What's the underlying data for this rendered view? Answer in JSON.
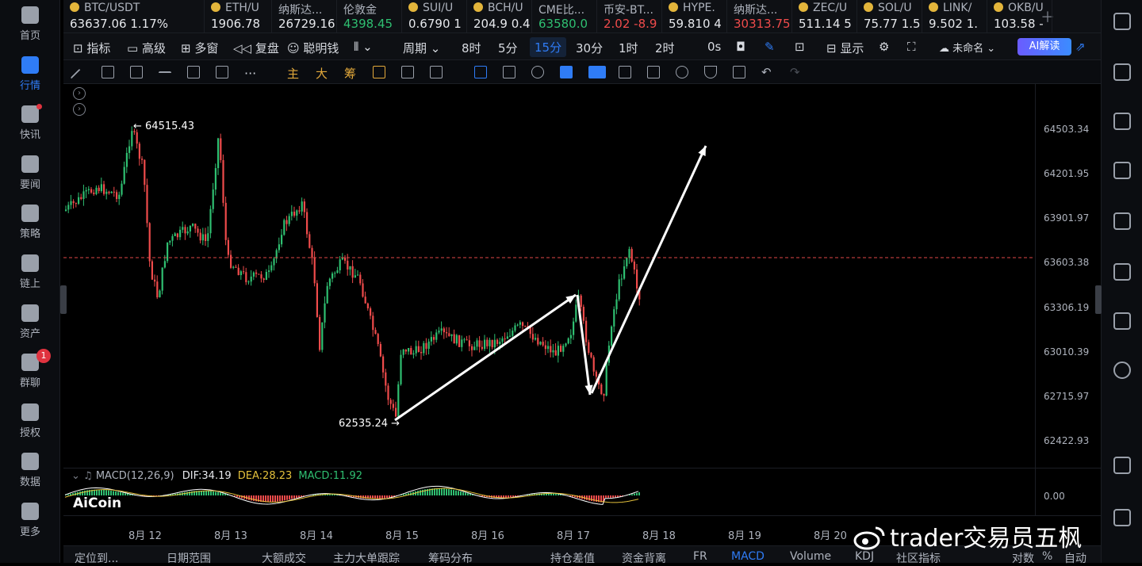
{
  "sidebar": {
    "items": [
      {
        "label": "首页",
        "icon": "home-icon"
      },
      {
        "label": "行情",
        "icon": "chart-bars-icon",
        "active": true
      },
      {
        "label": "快讯",
        "icon": "news-icon",
        "dot": true
      },
      {
        "label": "要闻",
        "icon": "document-icon"
      },
      {
        "label": "策略",
        "icon": "robot-icon"
      },
      {
        "label": "链上",
        "icon": "chain-icon"
      },
      {
        "label": "资产",
        "icon": "wallet-icon"
      },
      {
        "label": "群聊",
        "icon": "chat-icon",
        "badge": "1"
      },
      {
        "label": "授权",
        "icon": "key-icon"
      },
      {
        "label": "数据",
        "icon": "data-chart-icon"
      },
      {
        "label": "更多",
        "icon": "grid-icon"
      }
    ]
  },
  "tickers": [
    {
      "name": "BTC/USDT",
      "price": "63637.06  1.17%",
      "trend": "flat",
      "coin": true
    },
    {
      "name": "ETH/U",
      "price": "1906.78",
      "trend": "flat",
      "coin": true
    },
    {
      "name": "纳斯达...",
      "price": "26729.16",
      "trend": "flat"
    },
    {
      "name": "伦敦金",
      "price": "4398.45",
      "trend": "up"
    },
    {
      "name": "SUI/U",
      "price": "0.6790  1",
      "trend": "flat",
      "coin": true
    },
    {
      "name": "BCH/U",
      "price": "204.9  0.4",
      "trend": "flat",
      "coin": true
    },
    {
      "name": "CME比...",
      "price": "63580.0",
      "trend": "up"
    },
    {
      "name": "币安-BT...",
      "price": "2.02  -8.9",
      "trend": "dn"
    },
    {
      "name": "HYPE.",
      "price": "59.810  4",
      "trend": "flat",
      "coin": true
    },
    {
      "name": "纳斯达...",
      "price": "30313.75",
      "trend": "dn"
    },
    {
      "name": "ZEC/U",
      "price": "511.14  5",
      "trend": "flat",
      "coin": true
    },
    {
      "name": "SOL/U",
      "price": "75.77  1.5",
      "trend": "flat",
      "coin": true
    },
    {
      "name": "LINK/",
      "price": "9.502  1.",
      "trend": "flat",
      "coin": true
    },
    {
      "name": "OKB/U",
      "price": "103.58  -",
      "trend": "flat",
      "coin": true
    }
  ],
  "toolbar": {
    "indicator": "指标",
    "advanced": "高级",
    "multi": "多窗",
    "replay": "复盘",
    "smart": "聪明钱",
    "period": "周期",
    "intervals": [
      "8时",
      "5分",
      "15分",
      "30分",
      "1时",
      "2时",
      "0s"
    ],
    "selected": "15分",
    "display": "显示",
    "unnamed": "未命名",
    "ai": "AI解读"
  },
  "drawbar": {
    "zhu": "主",
    "da": "大",
    "chou": "筹"
  },
  "chart": {
    "y_ticks": [
      "64503.34",
      "64201.95",
      "63901.97",
      "63603.38",
      "63306.19",
      "63010.39",
      "62715.97",
      "62422.93",
      "0.00"
    ],
    "high_label": "← 64515.43",
    "low_label": "62535.24 →",
    "macd_name": "MACD(12,26,9)",
    "dif": "DIF:34.19",
    "dea": "DEA:28.23",
    "macd": "MACD:11.92",
    "x_ticks": [
      "8月 12",
      "8月 13",
      "8月 14",
      "8月 15",
      "8月 16",
      "8月 17",
      "8月 18",
      "8月 19",
      "8月 20"
    ],
    "logo": "AiCoin"
  },
  "bottom": {
    "tabs": [
      "定位到...",
      "日期范围",
      "大额成交",
      "主力大单跟踪",
      "筹码分布",
      "持仓差值",
      "资金背离",
      "FR",
      "MACD",
      "Volume",
      "KDJ",
      "社区指标",
      "对数",
      "%",
      "自动"
    ],
    "active": "MACD"
  },
  "watermark": "trader交易员五枫",
  "colors": {
    "up": "#2fbf71",
    "down": "#ef4b4b",
    "accent": "#2f7cf6"
  }
}
